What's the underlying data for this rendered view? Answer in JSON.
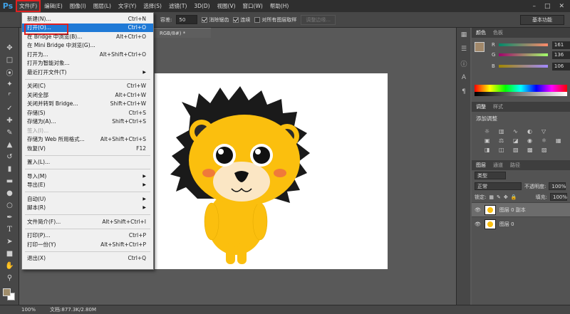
{
  "app": {
    "logo": "Ps"
  },
  "menubar": {
    "items": [
      "文件(F)",
      "编辑(E)",
      "图像(I)",
      "图层(L)",
      "文字(Y)",
      "选择(S)",
      "滤镜(T)",
      "3D(D)",
      "视图(V)",
      "窗口(W)",
      "帮助(H)"
    ]
  },
  "options": {
    "tolerance_label": "容差:",
    "tolerance_value": "50",
    "antialias_label": "消除锯齿",
    "contiguous_label": "连续",
    "all_layers_label": "对所有图层取样",
    "refine_edge_label": "调整边缘...",
    "workspace": "基本功能"
  },
  "document": {
    "tab_title": "RGB/8#) *"
  },
  "file_menu": {
    "items": [
      {
        "label": "新建(N)...",
        "shortcut": "Ctrl+N"
      },
      {
        "label": "打开(O)...",
        "shortcut": "Ctrl+O",
        "highlighted": true
      },
      {
        "label": "在 Bridge 中浏览(B)...",
        "shortcut": "Alt+Ctrl+O"
      },
      {
        "label": "在 Mini Bridge 中浏览(G)...",
        "shortcut": ""
      },
      {
        "label": "打开为...",
        "shortcut": "Alt+Shift+Ctrl+O"
      },
      {
        "label": "打开为智能对象...",
        "shortcut": ""
      },
      {
        "label": "最近打开文件(T)",
        "shortcut": "",
        "submenu": true
      },
      {
        "sep": true
      },
      {
        "label": "关闭(C)",
        "shortcut": "Ctrl+W"
      },
      {
        "label": "关闭全部",
        "shortcut": "Alt+Ctrl+W"
      },
      {
        "label": "关闭并转到 Bridge...",
        "shortcut": "Shift+Ctrl+W"
      },
      {
        "label": "存储(S)",
        "shortcut": "Ctrl+S"
      },
      {
        "label": "存储为(A)...",
        "shortcut": "Shift+Ctrl+S"
      },
      {
        "label": "签入(I)...",
        "shortcut": "",
        "disabled": true
      },
      {
        "label": "存储为 Web 所用格式...",
        "shortcut": "Alt+Shift+Ctrl+S"
      },
      {
        "label": "恢复(V)",
        "shortcut": "F12"
      },
      {
        "sep": true
      },
      {
        "label": "置入(L)...",
        "shortcut": ""
      },
      {
        "sep": true
      },
      {
        "label": "导入(M)",
        "shortcut": "",
        "submenu": true
      },
      {
        "label": "导出(E)",
        "shortcut": "",
        "submenu": true
      },
      {
        "sep": true
      },
      {
        "label": "自动(U)",
        "shortcut": "",
        "submenu": true
      },
      {
        "label": "脚本(R)",
        "shortcut": "",
        "submenu": true
      },
      {
        "sep": true
      },
      {
        "label": "文件简介(F)...",
        "shortcut": "Alt+Shift+Ctrl+I"
      },
      {
        "sep": true
      },
      {
        "label": "打印(P)...",
        "shortcut": "Ctrl+P"
      },
      {
        "label": "打印一份(Y)",
        "shortcut": "Alt+Shift+Ctrl+P"
      },
      {
        "sep": true
      },
      {
        "label": "退出(X)",
        "shortcut": "Ctrl+Q"
      }
    ]
  },
  "color_panel": {
    "tabs": [
      "颜色",
      "色板"
    ],
    "r_label": "R",
    "g_label": "G",
    "b_label": "B",
    "r": "161",
    "g": "136",
    "b": "106",
    "fg_color": "#a1886a"
  },
  "adjustments_panel": {
    "tabs": [
      "调整",
      "样式"
    ],
    "title": "添加调整"
  },
  "layers_panel": {
    "tabs": [
      "图层",
      "通道",
      "路径"
    ],
    "kind": "类型",
    "blend_mode": "正常",
    "opacity_label": "不透明度:",
    "opacity": "100%",
    "lock_label": "锁定:",
    "fill_label": "填充:",
    "fill": "100%",
    "layers": [
      {
        "name": "图层 0 副本",
        "selected": true
      },
      {
        "name": "图层 0",
        "selected": false
      }
    ]
  },
  "status": {
    "zoom": "100%",
    "doc_info": "文档:877.3K/2.80M"
  }
}
